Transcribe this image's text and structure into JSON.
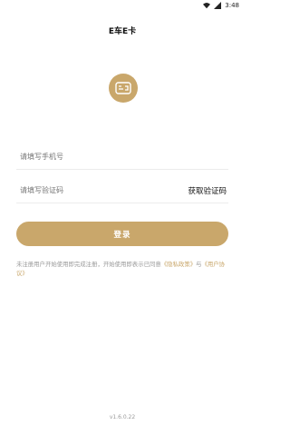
{
  "status_bar": {
    "time": "3:48",
    "wifi_icon": "wifi-icon",
    "signal_icon": "signal-icon"
  },
  "header": {
    "title": "E车E卡"
  },
  "logo": {
    "icon": "card-logo-icon",
    "color": "#c9a76b"
  },
  "form": {
    "phone_placeholder": "请填写手机号",
    "code_placeholder": "请填写验证码",
    "get_code_label": "获取验证码",
    "login_label": "登录"
  },
  "agreement": {
    "text_prefix": "未注册用户开始使用即完成注册，开始使用即表示已同意",
    "privacy_link": "《隐私政策》",
    "connector": "与",
    "user_link": "《用户协议》"
  },
  "footer": {
    "version": "v1.6.0.22"
  },
  "theme": {
    "accent": "#c9a76b"
  }
}
